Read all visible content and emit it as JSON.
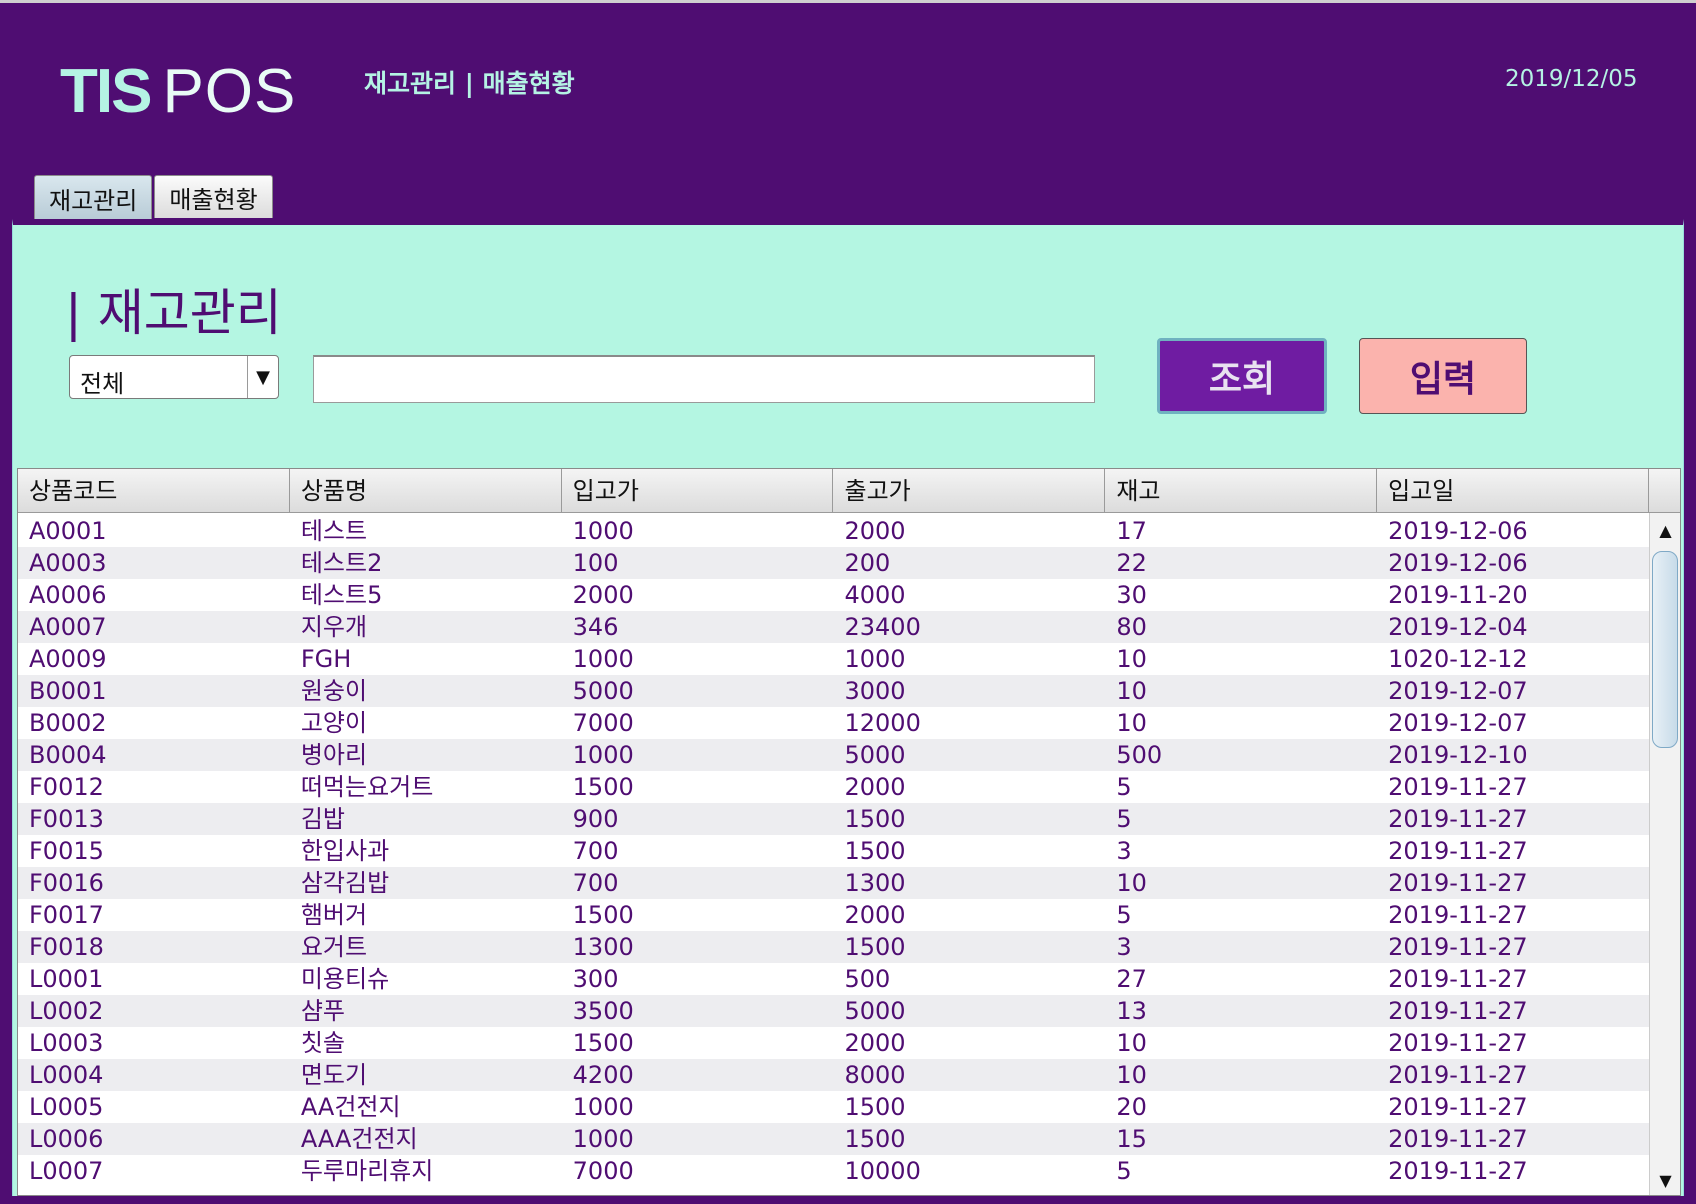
{
  "app": {
    "logo_main": "TIS",
    "logo_sub": "POS"
  },
  "header": {
    "nav_inventory": "재고관리",
    "nav_separator": "|",
    "nav_sales": "매출현황",
    "date": "2019/12/05"
  },
  "tabs": [
    {
      "label": "재고관리",
      "active": true
    },
    {
      "label": "매출현황",
      "active": false
    }
  ],
  "page": {
    "title": "| 재고관리",
    "category_value": "전체",
    "search_value": "",
    "search_button": "조회",
    "input_button": "입력"
  },
  "table": {
    "columns": [
      "상품코드",
      "상품명",
      "입고가",
      "출고가",
      "재고",
      "입고일"
    ],
    "rows": [
      [
        "A0001",
        "테스트",
        "1000",
        "2000",
        "17",
        "2019-12-06"
      ],
      [
        "A0003",
        "테스트2",
        "100",
        "200",
        "22",
        "2019-12-06"
      ],
      [
        "A0006",
        "테스트5",
        "2000",
        "4000",
        "30",
        "2019-11-20"
      ],
      [
        "A0007",
        "지우개",
        "346",
        "23400",
        "80",
        "2019-12-04"
      ],
      [
        "A0009",
        "FGH",
        "1000",
        "1000",
        "10",
        "1020-12-12"
      ],
      [
        "B0001",
        "원숭이",
        "5000",
        "3000",
        "10",
        "2019-12-07"
      ],
      [
        "B0002",
        "고양이",
        "7000",
        "12000",
        "10",
        "2019-12-07"
      ],
      [
        "B0004",
        "병아리",
        "1000",
        "5000",
        "500",
        "2019-12-10"
      ],
      [
        "F0012",
        "떠먹는요거트",
        "1500",
        "2000",
        "5",
        "2019-11-27"
      ],
      [
        "F0013",
        "김밥",
        "900",
        "1500",
        "5",
        "2019-11-27"
      ],
      [
        "F0015",
        "한입사과",
        "700",
        "1500",
        "3",
        "2019-11-27"
      ],
      [
        "F0016",
        "삼각김밥",
        "700",
        "1300",
        "10",
        "2019-11-27"
      ],
      [
        "F0017",
        "햄버거",
        "1500",
        "2000",
        "5",
        "2019-11-27"
      ],
      [
        "F0018",
        "요거트",
        "1300",
        "1500",
        "3",
        "2019-11-27"
      ],
      [
        "L0001",
        "미용티슈",
        "300",
        "500",
        "27",
        "2019-11-27"
      ],
      [
        "L0002",
        "샴푸",
        "3500",
        "5000",
        "13",
        "2019-11-27"
      ],
      [
        "L0003",
        "칫솔",
        "1500",
        "2000",
        "10",
        "2019-11-27"
      ],
      [
        "L0004",
        "면도기",
        "4200",
        "8000",
        "10",
        "2019-11-27"
      ],
      [
        "L0005",
        "AA건전지",
        "1000",
        "1500",
        "20",
        "2019-11-27"
      ],
      [
        "L0006",
        "AAA건전지",
        "1000",
        "1500",
        "15",
        "2019-11-27"
      ],
      [
        "L0007",
        "두루마리휴지",
        "7000",
        "10000",
        "5",
        "2019-11-27"
      ]
    ]
  },
  "scrollbar": {
    "up_icon": "▲",
    "down_icon": "▼"
  },
  "colors": {
    "brand_purple": "#4f0d72",
    "panel_mint": "#b4f6e2",
    "search_button": "#6f1ca2",
    "input_button": "#fbb3ad",
    "logo_mint": "#b5f3e4"
  }
}
